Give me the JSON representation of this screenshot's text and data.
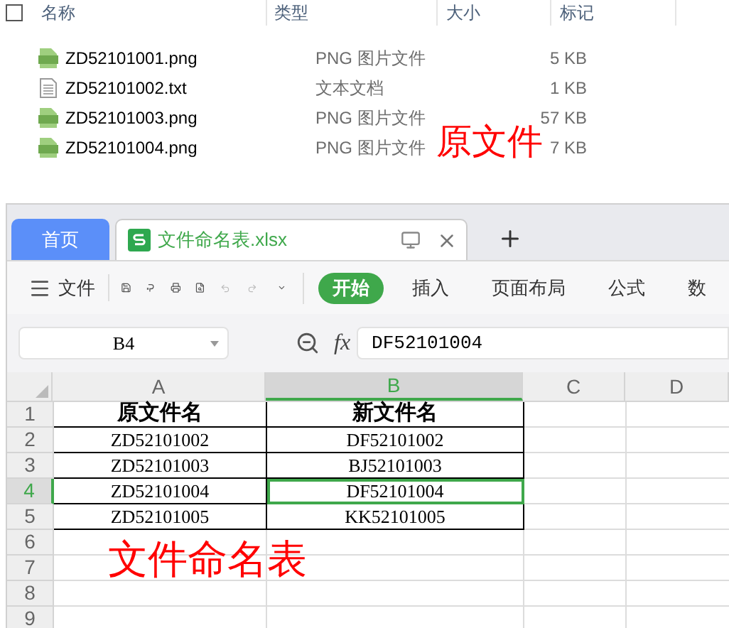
{
  "explorer": {
    "select_all": {
      "checked": false
    },
    "columns": [
      "名称",
      "类型",
      "大小",
      "标记"
    ],
    "files": [
      {
        "kind": "image",
        "name": "ZD52101001.png",
        "type": "PNG 图片文件",
        "size": "5 KB"
      },
      {
        "kind": "text",
        "name": "ZD52101002.txt",
        "type": "文本文档",
        "size": "1 KB"
      },
      {
        "kind": "image",
        "name": "ZD52101003.png",
        "type": "PNG 图片文件",
        "size": "57 KB"
      },
      {
        "kind": "image",
        "name": "ZD52101004.png",
        "type": "PNG 图片文件",
        "size": "7 KB"
      }
    ],
    "caption": "原文件"
  },
  "spreadsheet": {
    "tabs": [
      {
        "kind": "home",
        "label": "首页",
        "selected": false
      },
      {
        "kind": "document",
        "label": "文件命名表.xlsx",
        "selected": true
      }
    ],
    "menu": "文件",
    "ribbon": [
      {
        "label": "开始",
        "selected": true
      },
      {
        "label": "插入",
        "selected": false
      },
      {
        "label": "页面布局",
        "selected": false
      },
      {
        "label": "公式",
        "selected": false
      },
      {
        "label": "数",
        "selected": false
      }
    ],
    "name_box": "B4",
    "fx": "fx",
    "formula": "DF52101004",
    "columns": [
      {
        "label": "A",
        "selected": false
      },
      {
        "label": "B",
        "selected": true
      },
      {
        "label": "C",
        "selected": false
      },
      {
        "label": "D",
        "selected": false
      }
    ],
    "rows": [
      {
        "number": "1",
        "kind": "header",
        "selected": false,
        "cells": [
          {
            "text": "原文件名",
            "selected": false
          },
          {
            "text": "新文件名",
            "selected": false
          }
        ]
      },
      {
        "number": "2",
        "kind": "data",
        "selected": false,
        "cells": [
          {
            "text": "ZD52101002",
            "selected": false
          },
          {
            "text": "DF52101002",
            "selected": false
          }
        ]
      },
      {
        "number": "3",
        "kind": "data",
        "selected": false,
        "cells": [
          {
            "text": "ZD52101003",
            "selected": false
          },
          {
            "text": "BJ52101003",
            "selected": false
          }
        ]
      },
      {
        "number": "4",
        "kind": "data",
        "selected": true,
        "cells": [
          {
            "text": "ZD52101004",
            "selected": false
          },
          {
            "text": "DF52101004",
            "selected": true
          }
        ]
      },
      {
        "number": "5",
        "kind": "data",
        "selected": false,
        "cells": [
          {
            "text": "ZD52101005",
            "selected": false
          },
          {
            "text": "KK52101005",
            "selected": false
          }
        ]
      },
      {
        "number": "6",
        "kind": "empty",
        "selected": false,
        "cells": []
      },
      {
        "number": "7",
        "kind": "empty",
        "selected": false,
        "cells": []
      },
      {
        "number": "8",
        "kind": "empty",
        "selected": false,
        "cells": []
      },
      {
        "number": "9",
        "kind": "empty",
        "selected": false,
        "cells": []
      }
    ],
    "caption": "文件命名表"
  }
}
